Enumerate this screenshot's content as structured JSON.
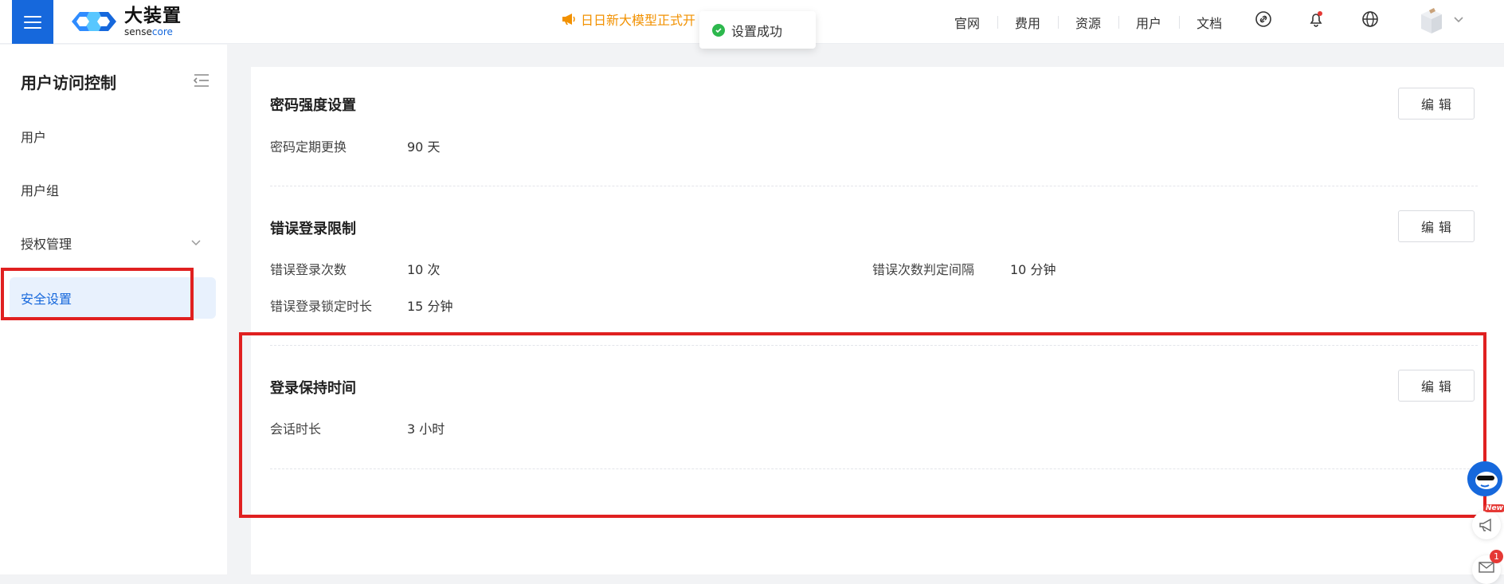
{
  "header": {
    "logo_cn": "大装置",
    "logo_en_prefix": "sense",
    "logo_en_suffix": "core",
    "announcement": "日日新大模型正式开",
    "nav": [
      "官网",
      "费用",
      "资源",
      "用户",
      "文档"
    ]
  },
  "toast": {
    "message": "设置成功"
  },
  "sidebar": {
    "title": "用户访问控制",
    "items": [
      {
        "label": "用户"
      },
      {
        "label": "用户组"
      },
      {
        "label": "授权管理"
      },
      {
        "label": "安全设置"
      }
    ]
  },
  "sections": {
    "password": {
      "title": "密码强度设置",
      "edit": "编辑",
      "rotation_label": "密码定期更换",
      "rotation_value": "90 天"
    },
    "login_limit": {
      "title": "错误登录限制",
      "edit": "编辑",
      "attempts_label": "错误登录次数",
      "attempts_value": "10 次",
      "interval_label": "错误次数判定间隔",
      "interval_value": "10 分钟",
      "lock_label": "错误登录锁定时长",
      "lock_value": "15 分钟"
    },
    "session": {
      "title": "登录保持时间",
      "edit": "编辑",
      "duration_label": "会话时长",
      "duration_value": "3 小时"
    }
  },
  "floating": {
    "new_tag": "New",
    "mail_count": "1"
  },
  "colors": {
    "primary": "#1668dc",
    "highlight": "#e02020",
    "announcement": "#f29100",
    "success": "#2db84d"
  }
}
